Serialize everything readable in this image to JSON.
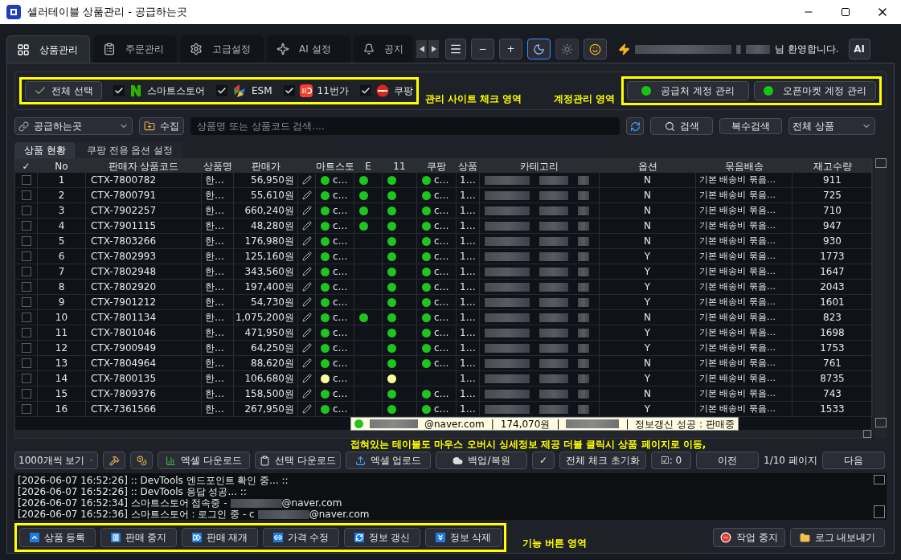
{
  "window": {
    "title": "셀러테이블 상품관리 - 공급하는곳"
  },
  "tabs": [
    {
      "label": "상품관리",
      "selected": true
    },
    {
      "label": "주문관리",
      "selected": false
    },
    {
      "label": "고급설정",
      "selected": false
    },
    {
      "label": "AI 설정",
      "selected": false
    },
    {
      "label": "공지",
      "selected": false
    }
  ],
  "zoom_buttons": [
    "−",
    "+"
  ],
  "theme_buttons": [
    {
      "kind": "moon",
      "selected": true
    },
    {
      "kind": "sun",
      "selected": false
    }
  ],
  "welcome": "님 환영합니다.",
  "ai_button": "AI",
  "select_all_button": "전체 선택",
  "sites": [
    {
      "label": "스마트스토어",
      "checked": true,
      "kind": "letter-n"
    },
    {
      "label": "ESM",
      "checked": true,
      "kind": "pinwheel"
    },
    {
      "label": "11번가",
      "checked": true,
      "kind": "badge"
    },
    {
      "label": "쿠팡",
      "checked": true,
      "kind": "disc"
    }
  ],
  "annotations": {
    "sites": "관리 사이트 체크 영역",
    "accounts": "계정관리 영역",
    "table": "접혀있는 테이블도 마우스 오버시 싱세정보 제공 더블 클릭시 상품 페이지로 이동,",
    "functions": "기능 버튼 영역"
  },
  "accounts": [
    {
      "label": "공급처 계정 관리",
      "on": true
    },
    {
      "label": "오픈마켓 계정 관리",
      "on": true
    }
  ],
  "supplier_select": "공급하는곳",
  "collect_button": "수집",
  "search": {
    "placeholder": "상품명 또는 상품코드 검색...."
  },
  "search_button": "검색",
  "multi_search_button": "복수검색",
  "filter_select": "전체 상품",
  "subtabs": [
    {
      "label": "상품 현황",
      "selected": true
    },
    {
      "label": "쿠팡 전용 옵션 설정",
      "selected": false
    }
  ],
  "table": {
    "columns": [
      "✓",
      "No",
      "판매자 상품코드",
      "상품명",
      "판매가",
      "마트스토",
      "E",
      "11",
      "쿠팡",
      "상품",
      "카테고리",
      "옵션",
      "묶음배송",
      "재고수량"
    ],
    "rows": [
      {
        "checked": false,
        "no": "1",
        "code": "CTX-7800782",
        "name": "한…",
        "price": "56,950원",
        "smartstore": {
          "color": "#1ec51e",
          "text": "c…"
        },
        "esm": {
          "color": "#1ec51e"
        },
        "st11": {
          "color": "#1ec51e"
        },
        "coupang": {
          "color": "#1ec51e",
          "text": "c…"
        },
        "column_10": "1…",
        "option": "N",
        "bundle": "기본 배송비 묶음…",
        "stock": "911"
      },
      {
        "checked": false,
        "no": "2",
        "code": "CTX-7800791",
        "name": "한…",
        "price": "55,610원",
        "smartstore": {
          "color": "#1ec51e",
          "text": "c…"
        },
        "esm": {
          "color": "#1ec51e"
        },
        "st11": {
          "color": "#1ec51e"
        },
        "coupang": {
          "color": "#1ec51e",
          "text": "c…"
        },
        "column_10": "1…",
        "option": "N",
        "bundle": "기본 배송비 묶음…",
        "stock": "725"
      },
      {
        "checked": false,
        "no": "3",
        "code": "CTX-7902257",
        "name": "한…",
        "price": "660,240원",
        "smartstore": {
          "color": "#1ec51e",
          "text": "c…"
        },
        "esm": {
          "color": "#1ec51e"
        },
        "st11": {
          "color": "#1ec51e"
        },
        "coupang": {
          "color": "#1ec51e",
          "text": "c…"
        },
        "column_10": "1…",
        "option": "N",
        "bundle": "기본 배송비 묶음…",
        "stock": "710"
      },
      {
        "checked": false,
        "no": "4",
        "code": "CTX-7901115",
        "name": "한…",
        "price": "48,280원",
        "smartstore": {
          "color": "#1ec51e",
          "text": "c…"
        },
        "esm": {
          "color": "#1ec51e"
        },
        "st11": {
          "color": "#1ec51e"
        },
        "coupang": {
          "color": "#1ec51e",
          "text": "c…"
        },
        "column_10": "1…",
        "option": "N",
        "bundle": "기본 배송비 묶음…",
        "stock": "947"
      },
      {
        "checked": false,
        "no": "5",
        "code": "CTX-7803266",
        "name": "한…",
        "price": "176,980원",
        "smartstore": {
          "color": "#1ec51e",
          "text": "c…"
        },
        "st11": {
          "color": "#1ec51e"
        },
        "coupang": {
          "color": "#1ec51e",
          "text": "c…"
        },
        "column_10": "1…",
        "option": "N",
        "bundle": "기본 배송비 묶음…",
        "stock": "930"
      },
      {
        "checked": false,
        "no": "6",
        "code": "CTX-7802993",
        "name": "한…",
        "price": "125,160원",
        "smartstore": {
          "color": "#1ec51e",
          "text": "c…"
        },
        "st11": {
          "color": "#1ec51e"
        },
        "coupang": {
          "color": "#1ec51e",
          "text": "c…"
        },
        "column_10": "1…",
        "option": "Y",
        "bundle": "기본 배송비 묶음…",
        "stock": "1773"
      },
      {
        "checked": false,
        "no": "7",
        "code": "CTX-7802948",
        "name": "한…",
        "price": "343,560원",
        "smartstore": {
          "color": "#1ec51e",
          "text": "c…"
        },
        "st11": {
          "color": "#1ec51e"
        },
        "coupang": {
          "color": "#1ec51e",
          "text": "c…"
        },
        "column_10": "1…",
        "option": "Y",
        "bundle": "기본 배송비 묶음…",
        "stock": "1647"
      },
      {
        "checked": false,
        "no": "8",
        "code": "CTX-7802920",
        "name": "한…",
        "price": "197,400원",
        "smartstore": {
          "color": "#1ec51e",
          "text": "c…"
        },
        "st11": {
          "color": "#1ec51e"
        },
        "coupang": {
          "color": "#1ec51e",
          "text": "c…"
        },
        "column_10": "1…",
        "option": "Y",
        "bundle": "기본 배송비 묶음…",
        "stock": "2043"
      },
      {
        "checked": false,
        "no": "9",
        "code": "CTX-7901212",
        "name": "한…",
        "price": "54,730원",
        "smartstore": {
          "color": "#1ec51e",
          "text": "c…"
        },
        "st11": {
          "color": "#1ec51e"
        },
        "coupang": {
          "color": "#1ec51e",
          "text": "c…"
        },
        "column_10": "1…",
        "option": "Y",
        "bundle": "기본 배송비 묶음…",
        "stock": "1601"
      },
      {
        "checked": false,
        "no": "10",
        "code": "CTX-7801134",
        "name": "한…",
        "price": "1,075,200원",
        "smartstore": {
          "color": "#1ec51e",
          "text": "c…"
        },
        "esm": {
          "color": "#1ec51e"
        },
        "st11": {
          "color": "#1ec51e"
        },
        "coupang": {
          "color": "#1ec51e",
          "text": "c…"
        },
        "column_10": "1…",
        "option": "N",
        "bundle": "기본 배송비 묶음…",
        "stock": "823"
      },
      {
        "checked": false,
        "no": "11",
        "code": "CTX-7801046",
        "name": "한…",
        "price": "471,950원",
        "smartstore": {
          "color": "#1ec51e",
          "text": "c…"
        },
        "st11": {
          "color": "#1ec51e"
        },
        "coupang": {
          "color": "#1ec51e",
          "text": "c…"
        },
        "column_10": "1…",
        "option": "Y",
        "bundle": "기본 배송비 묶음…",
        "stock": "1698"
      },
      {
        "checked": false,
        "no": "12",
        "code": "CTX-7900949",
        "name": "한…",
        "price": "64,250원",
        "smartstore": {
          "color": "#1ec51e",
          "text": "c…"
        },
        "st11": {
          "color": "#1ec51e"
        },
        "coupang": {
          "color": "#1ec51e",
          "text": "c…"
        },
        "column_10": "1…",
        "option": "Y",
        "bundle": "기본 배송비 묶음…",
        "stock": "1753"
      },
      {
        "checked": false,
        "no": "13",
        "code": "CTX-7804964",
        "name": "한…",
        "price": "88,620원",
        "smartstore": {
          "color": "#1ec51e",
          "text": "c…"
        },
        "st11": {
          "color": "#1ec51e"
        },
        "coupang": {
          "color": "#1ec51e",
          "text": "c…"
        },
        "column_10": "1…",
        "option": "N",
        "bundle": "기본 배송비 묶음…",
        "stock": "761"
      },
      {
        "checked": false,
        "no": "14",
        "code": "CTX-7800135",
        "name": "한…",
        "price": "106,680원",
        "smartstore": {
          "color": "#ffff99",
          "text": "c…"
        },
        "st11": {
          "color": "#ffff99"
        },
        "column_10": "1…",
        "option": "Y",
        "bundle": "기본 배송비 묶음…",
        "stock": "8735"
      },
      {
        "checked": false,
        "no": "15",
        "code": "CTX-7809376",
        "name": "한…",
        "price": "158,500원",
        "smartstore": {
          "color": "#1ec51e",
          "text": "c…"
        },
        "st11": {
          "color": "#1ec51e"
        },
        "coupang": {
          "color": "#1ec51e",
          "text": "c…"
        },
        "column_10": "1…",
        "option": "N",
        "bundle": "기본 배송비 묶음…",
        "stock": "743"
      },
      {
        "checked": false,
        "no": "16",
        "code": "CTX-7361566",
        "name": "한…",
        "price": "267,950원",
        "smartstore": {
          "color": "#1ec51e",
          "text": "c…"
        },
        "st11": {
          "color": "#1ec51e"
        },
        "coupang": {
          "color": "#1ec51e",
          "text": "c…"
        },
        "column_10": "1…",
        "option": "Y",
        "bundle": "기본 배송비 묶음…",
        "stock": "1533"
      }
    ]
  },
  "tooltip": {
    "email_domain": "@naver.com",
    "price": "174,070원",
    "status": "정보갱신 성공 : 판매중",
    "separator": "|"
  },
  "page_size_select": "1000개씩 보기",
  "toolbar": {
    "excel_download": "엑셀 다운로드",
    "selected_download": "선택 다운로드",
    "excel_upload": "엑셀 업로드",
    "backup": "백업/복원",
    "check": "✓",
    "reset_checks": "전체 체크 초기화",
    "checked_count": "☑: 0",
    "prev": "이전",
    "page": "1/10 페이지",
    "next": "다음"
  },
  "log": [
    {
      "time": "[2026-06-07 16:52:26]",
      "text": ":: DevTools 엔드포인트 확인 중... ::"
    },
    {
      "time": "[2026-06-07 16:52:26]",
      "text": ":: DevTools 응답 성공... ::"
    },
    {
      "time": "[2026-06-07 16:52:34]",
      "text": "스마트스토어 접속중 -",
      "email_domain": "@naver.com"
    },
    {
      "time": "[2026-06-07 16:52:36]",
      "text": "스마트스토어 : 로그인 중 - c",
      "email_domain": "@naver.com"
    }
  ],
  "function_buttons": [
    "상품 등록",
    "판매 중지",
    "판매 재개",
    "가격 수정",
    "정보 갱신",
    "정보 삭제"
  ],
  "stop_button": "작업 중지",
  "export_log_button": "로그 내보내기"
}
